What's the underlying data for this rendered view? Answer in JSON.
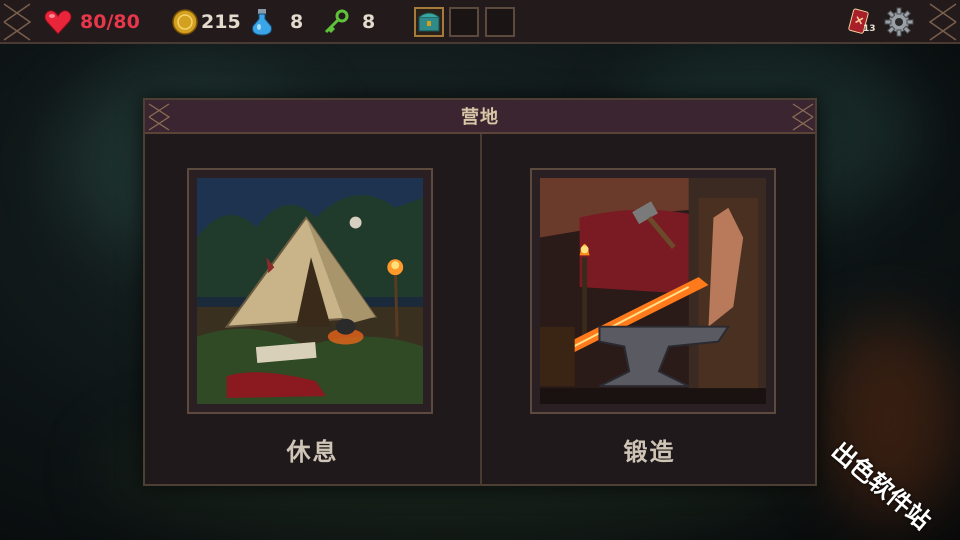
{
  "hud": {
    "hp": "80/80",
    "gold": "215",
    "potions": "8",
    "keys": "8",
    "inventory_slots": [
      {
        "filled": true,
        "icon": "treasure-chest-icon"
      },
      {
        "filled": false
      },
      {
        "filled": false
      }
    ],
    "deck_count": "13",
    "icons": {
      "hp": "heart-icon",
      "gold": "coin-icon",
      "potion": "potion-icon",
      "key": "key-icon",
      "deck": "card-deck-icon",
      "settings": "gear-icon"
    }
  },
  "dialog": {
    "title": "营地",
    "options": [
      {
        "label": "休息",
        "art": "camp-tent-scene"
      },
      {
        "label": "锻造",
        "art": "blacksmith-anvil-scene"
      }
    ]
  },
  "watermark": "出色软件站",
  "colors": {
    "hp": "#e8374a",
    "header": "#3a2530",
    "panel": "#1f191b",
    "border": "#4e3f35"
  }
}
